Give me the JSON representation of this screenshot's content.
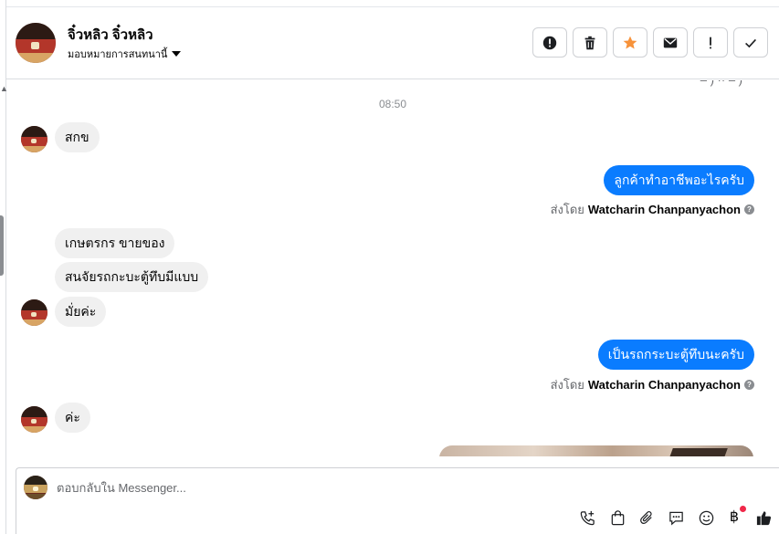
{
  "header": {
    "contact_name": "จิ๋วหลิว จิ๋วหลิว",
    "assign_label": "มอบหมายการสนทนานี้"
  },
  "header_actions": [
    {
      "icon": "alert-circle-icon"
    },
    {
      "icon": "trash-icon"
    },
    {
      "icon": "star-icon"
    },
    {
      "icon": "envelope-icon"
    },
    {
      "icon": "exclamation-icon"
    },
    {
      "icon": "checkmark-icon"
    }
  ],
  "thread": {
    "timestamp": "08:50",
    "messages": [
      {
        "from": "customer",
        "text": "สกข"
      },
      {
        "from": "page",
        "text": "ลูกค้าทำอาชีพอะไรครับ",
        "sent_by_label": "ส่งโดย",
        "sent_by_name": "Watcharin Chanpanyachon"
      },
      {
        "from": "customer",
        "text": "เกษตรกร ขายของ"
      },
      {
        "from": "customer",
        "text": "สนจัยรถกะบะตู้ทึบมีแบบ"
      },
      {
        "from": "customer",
        "text": "มั่ยค่ะ"
      },
      {
        "from": "page",
        "text": "เป็นรถกระบะตู้ทึบนะครับ",
        "sent_by_label": "ส่งโดย",
        "sent_by_name": "Watcharin Chanpanyachon"
      },
      {
        "from": "customer",
        "text": "ค่ะ"
      }
    ]
  },
  "composer": {
    "placeholder": "ตอบกลับใน Messenger...",
    "currency_symbol": "฿"
  },
  "colors": {
    "outgoing_bubble": "#0a7cff",
    "incoming_bubble": "#f0f0f0",
    "star": "#f7923a",
    "badge": "#f02849"
  }
}
